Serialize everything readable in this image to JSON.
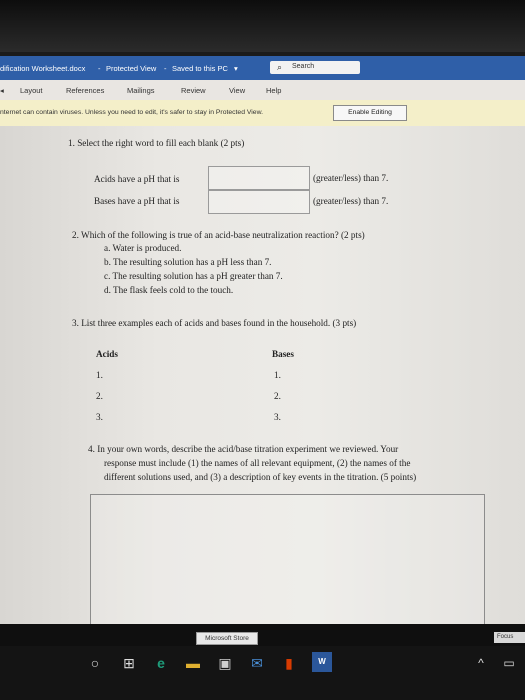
{
  "window": {
    "title": "dification Worksheet.docx",
    "mode": "Protected View",
    "saved": "Saved to this PC",
    "search_label": "Search"
  },
  "ribbon": {
    "tabs": [
      "Layout",
      "References",
      "Mailings",
      "Review",
      "View",
      "Help"
    ]
  },
  "protected_bar": {
    "message": "nternet can contain viruses. Unless you need to edit, it's safer to stay in Protected View.",
    "button": "Enable Editing"
  },
  "doc": {
    "q1": {
      "prompt": "1.  Select the right word to fill each blank (2 pts)",
      "rows": [
        {
          "left": "Acids have a pH that is",
          "right": "(greater/less) than 7."
        },
        {
          "left": "Bases have a pH that is",
          "right": "(greater/less) than 7."
        }
      ]
    },
    "q2": {
      "prompt": "2.  Which of the following is true of an acid-base neutralization reaction? (2 pts)",
      "options": [
        "a.   Water is produced.",
        "b.   The resulting solution has a pH less than 7.",
        "c.   The resulting solution has a pH greater than 7.",
        "d.   The flask feels cold to the touch."
      ]
    },
    "q3": {
      "prompt": "3.  List three examples each of acids and bases found in the household. (3 pts)",
      "acids_header": "Acids",
      "bases_header": "Bases",
      "acids": [
        "1.",
        "2.",
        "3."
      ],
      "bases": [
        "1.",
        "2.",
        "3."
      ]
    },
    "q4": {
      "lines": [
        "4.  In your own words, describe the acid/base titration experiment we reviewed. Your",
        "response must include (1) the names of all relevant equipment, (2) the names of the",
        "different solutions used, and (3) a description of key events in the titration. (5 points)"
      ]
    }
  },
  "taskbar": {
    "store_label": "Microsoft Store",
    "focus_label": "Focus",
    "word_badge": "W"
  },
  "colors": {
    "title_blue": "#2f5fa8",
    "protected_yellow": "#f4efc9",
    "edge_green": "#1e9c7a",
    "office_red": "#d83b01"
  }
}
